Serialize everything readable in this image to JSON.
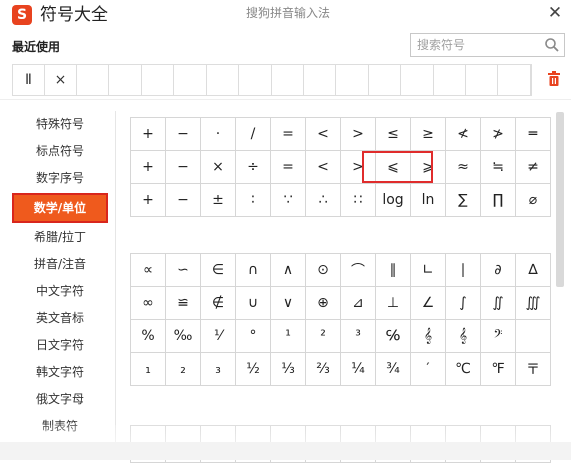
{
  "app_title": "符号大全",
  "logo_letter": "S",
  "ime_title": "搜狗拼音输入法",
  "close_label": "✕",
  "recent_label": "最近使用",
  "search_placeholder": "搜索符号",
  "recent_symbols": [
    "Ⅱ",
    "×"
  ],
  "sidebar": [
    {
      "label": "特殊符号"
    },
    {
      "label": "标点符号"
    },
    {
      "label": "数字序号"
    },
    {
      "label": "数学/单位",
      "active": true
    },
    {
      "label": "希腊/拉丁"
    },
    {
      "label": "拼音/注音"
    },
    {
      "label": "中文字符"
    },
    {
      "label": "英文音标"
    },
    {
      "label": "日文字符"
    },
    {
      "label": "韩文字符"
    },
    {
      "label": "俄文字母"
    },
    {
      "label": "制表符"
    }
  ],
  "grid1": [
    [
      "+",
      "−",
      "·",
      "/",
      "=",
      "<",
      ">",
      "≤",
      "≥",
      "≮",
      "≯",
      "═"
    ],
    [
      "+",
      "−",
      "×",
      "÷",
      "=",
      "<",
      ">",
      "⩽",
      "⩾",
      "≈",
      "≒",
      "≠"
    ],
    [
      "+",
      "−",
      "±",
      "∶",
      "∵",
      "∴",
      "∷",
      "log",
      "ln",
      "∑",
      "∏",
      "⌀"
    ]
  ],
  "grid2": [
    [
      "∝",
      "∽",
      "∈",
      "∩",
      "∧",
      "⊙",
      "⌒",
      "∥",
      "∟",
      "∣",
      "∂",
      "∆"
    ],
    [
      "∞",
      "≌",
      "∉",
      "∪",
      "∨",
      "⊕",
      "⊿",
      "⊥",
      "∠",
      "∫",
      "∬",
      "∭"
    ],
    [
      "%",
      "‰",
      "⅟",
      "°",
      "¹",
      "²",
      "³",
      "℅",
      "𝄞",
      "𝄞",
      "𝄢",
      ""
    ],
    [
      "₁",
      "₂",
      "₃",
      "½",
      "⅓",
      "⅔",
      "¼",
      "¾",
      "′",
      "℃",
      "℉",
      "〒"
    ]
  ],
  "grid3": [
    [
      "",
      "",
      "",
      "",
      "",
      "",
      "",
      "",
      "",
      "",
      "",
      ""
    ]
  ]
}
